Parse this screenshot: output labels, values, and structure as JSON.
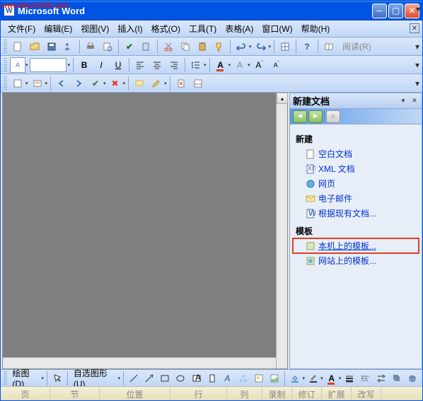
{
  "watermark": "www.blue1000.com",
  "title": "Microsoft Word",
  "menu": {
    "file": "文件(F)",
    "edit": "编辑(E)",
    "view": "视图(V)",
    "insert": "插入(I)",
    "format": "格式(O)",
    "tools": "工具(T)",
    "table": "表格(A)",
    "window": "窗口(W)",
    "help": "帮助(H)"
  },
  "toolbar": {
    "read_label": "阅读(R)"
  },
  "task_pane": {
    "title": "新建文档",
    "section_new": "新建",
    "links_new": {
      "blank": "空白文档",
      "xml": "XML 文档",
      "web": "网页",
      "email": "电子邮件",
      "existing": "根据现有文档..."
    },
    "section_tpl": "模板",
    "links_tpl": {
      "local": "本机上的模板...",
      "web": "网站上的模板..."
    }
  },
  "draw_bar": {
    "draw": "绘图(D)",
    "autoshape": "自选图形(U)"
  },
  "statusbar": {
    "page": "页",
    "sec": "节",
    "pos": "位置",
    "ln": "行",
    "col": "列",
    "rec": "录制",
    "trk": "修订",
    "ext": "扩展",
    "ovr": "改写"
  }
}
